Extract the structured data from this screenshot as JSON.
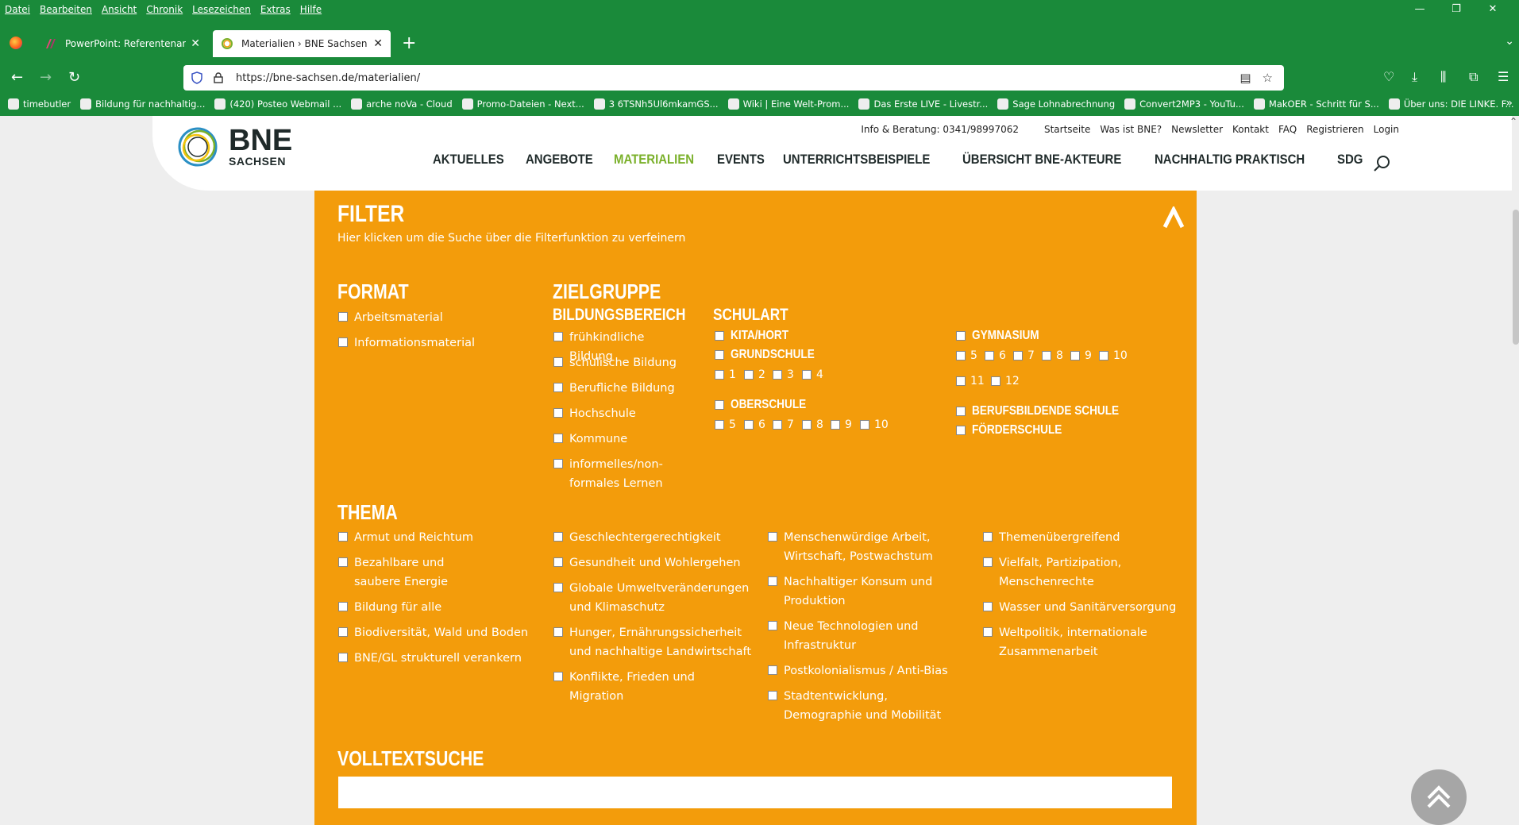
{
  "menubar": [
    "Datei",
    "Bearbeiten",
    "Ansicht",
    "Chronik",
    "Lesezeichen",
    "Extras",
    "Hilfe"
  ],
  "tabs": [
    {
      "title": "PowerPoint: Referentenansicht"
    },
    {
      "title": "Materialien › BNE Sachsen"
    }
  ],
  "address": {
    "url": "https://bne-sachsen.de/materialien/"
  },
  "bookmarks": [
    "timebutler",
    "Bildung für nachhaltig...",
    "(420) Posteo Webmail ...",
    "arche noVa - Cloud",
    "Promo-Dateien - Next...",
    "3 6TSNh5Ul6mkamGS...",
    "Wiki | Eine Welt-Prom...",
    "Das Erste LIVE - Livestr...",
    "Sage Lohnabrechnung",
    "Convert2MP3 - YouTu...",
    "MakOER - Schritt für S...",
    "Über uns: DIE LINKE. F..."
  ],
  "site": {
    "logo_main": "BNE",
    "logo_sub": "SACHSEN",
    "info": "Info & Beratung: 0341/98997062",
    "toplinks": [
      "Startseite",
      "Was ist BNE?",
      "Newsletter",
      "Kontakt",
      "FAQ",
      "Registrieren",
      "Login"
    ],
    "nav": [
      "AKTUELLES",
      "ANGEBOTE",
      "MATERIALIEN",
      "EVENTS",
      "UNTERRICHTSBEISPIELE",
      "ÜBERSICHT BNE-AKTEURE",
      "NACHHALTIG PRAKTISCH",
      "SDG"
    ]
  },
  "filter": {
    "title": "FILTER",
    "subtitle": "Hier klicken um die Suche über die Filterfunktion zu verfeinern",
    "format_title": "FORMAT",
    "format": [
      "Arbeitsmaterial",
      "Informationsmaterial"
    ],
    "zielgruppe_title": "ZIELGRUPPE",
    "bildungsbereich_title": "BILDUNGSBEREICH",
    "bildungsbereich": [
      "frühkindliche Bildung",
      "schulische Bildung",
      "Berufliche Bildung",
      "Hochschule",
      "Kommune",
      "informelles/non-formales Lernen"
    ],
    "schulart_title": "SCHULART",
    "kita": "KITA/HORT",
    "grundschule": "GRUNDSCHULE",
    "grund_classes": [
      "1",
      "2",
      "3",
      "4"
    ],
    "oberschule": "OBERSCHULE",
    "ober_classes": [
      "5",
      "6",
      "7",
      "8",
      "9",
      "10"
    ],
    "gymnasium": "GYMNASIUM",
    "gym_classes": [
      "5",
      "6",
      "7",
      "8",
      "9",
      "10",
      "11",
      "12"
    ],
    "berufsbildende": "BERUFSBILDENDE SCHULE",
    "foerderschule": "FÖRDERSCHULE",
    "thema_title": "THEMA",
    "thema_col1": [
      "Armut und Reichtum",
      "Bezahlbare und saubere Energie",
      "Bildung für alle",
      "Biodiversität, Wald und Boden",
      "BNE/GL strukturell verankern"
    ],
    "thema_col2": [
      "Geschlechtergerechtigkeit",
      "Gesundheit und Wohlergehen",
      "Globale Umweltveränderungen und Klimaschutz",
      "Hunger, Ernährungssicherheit und nachhaltige Landwirtschaft",
      "Konflikte, Frieden und Migration"
    ],
    "thema_col3": [
      "Menschenwürdige Arbeit, Wirtschaft, Postwachstum",
      "Nachhaltiger Konsum und Produktion",
      "Neue Technologien und Infrastruktur",
      "Postkolonialismus / Anti-Bias",
      "Stadtentwicklung, Demographie und Mobilität"
    ],
    "thema_col4": [
      "Themenübergreifend",
      "Vielfalt, Partizipation, Menschenrechte",
      "Wasser und Sanitärversorgung",
      "Weltpolitik, internationale Zusammenarbeit"
    ],
    "volltext_title": "VOLLTEXTSUCHE"
  },
  "colors": {
    "accent_orange": "#f39c0b",
    "nav_active_green": "#7ab02a",
    "browser_green": "#1a8a3a"
  }
}
